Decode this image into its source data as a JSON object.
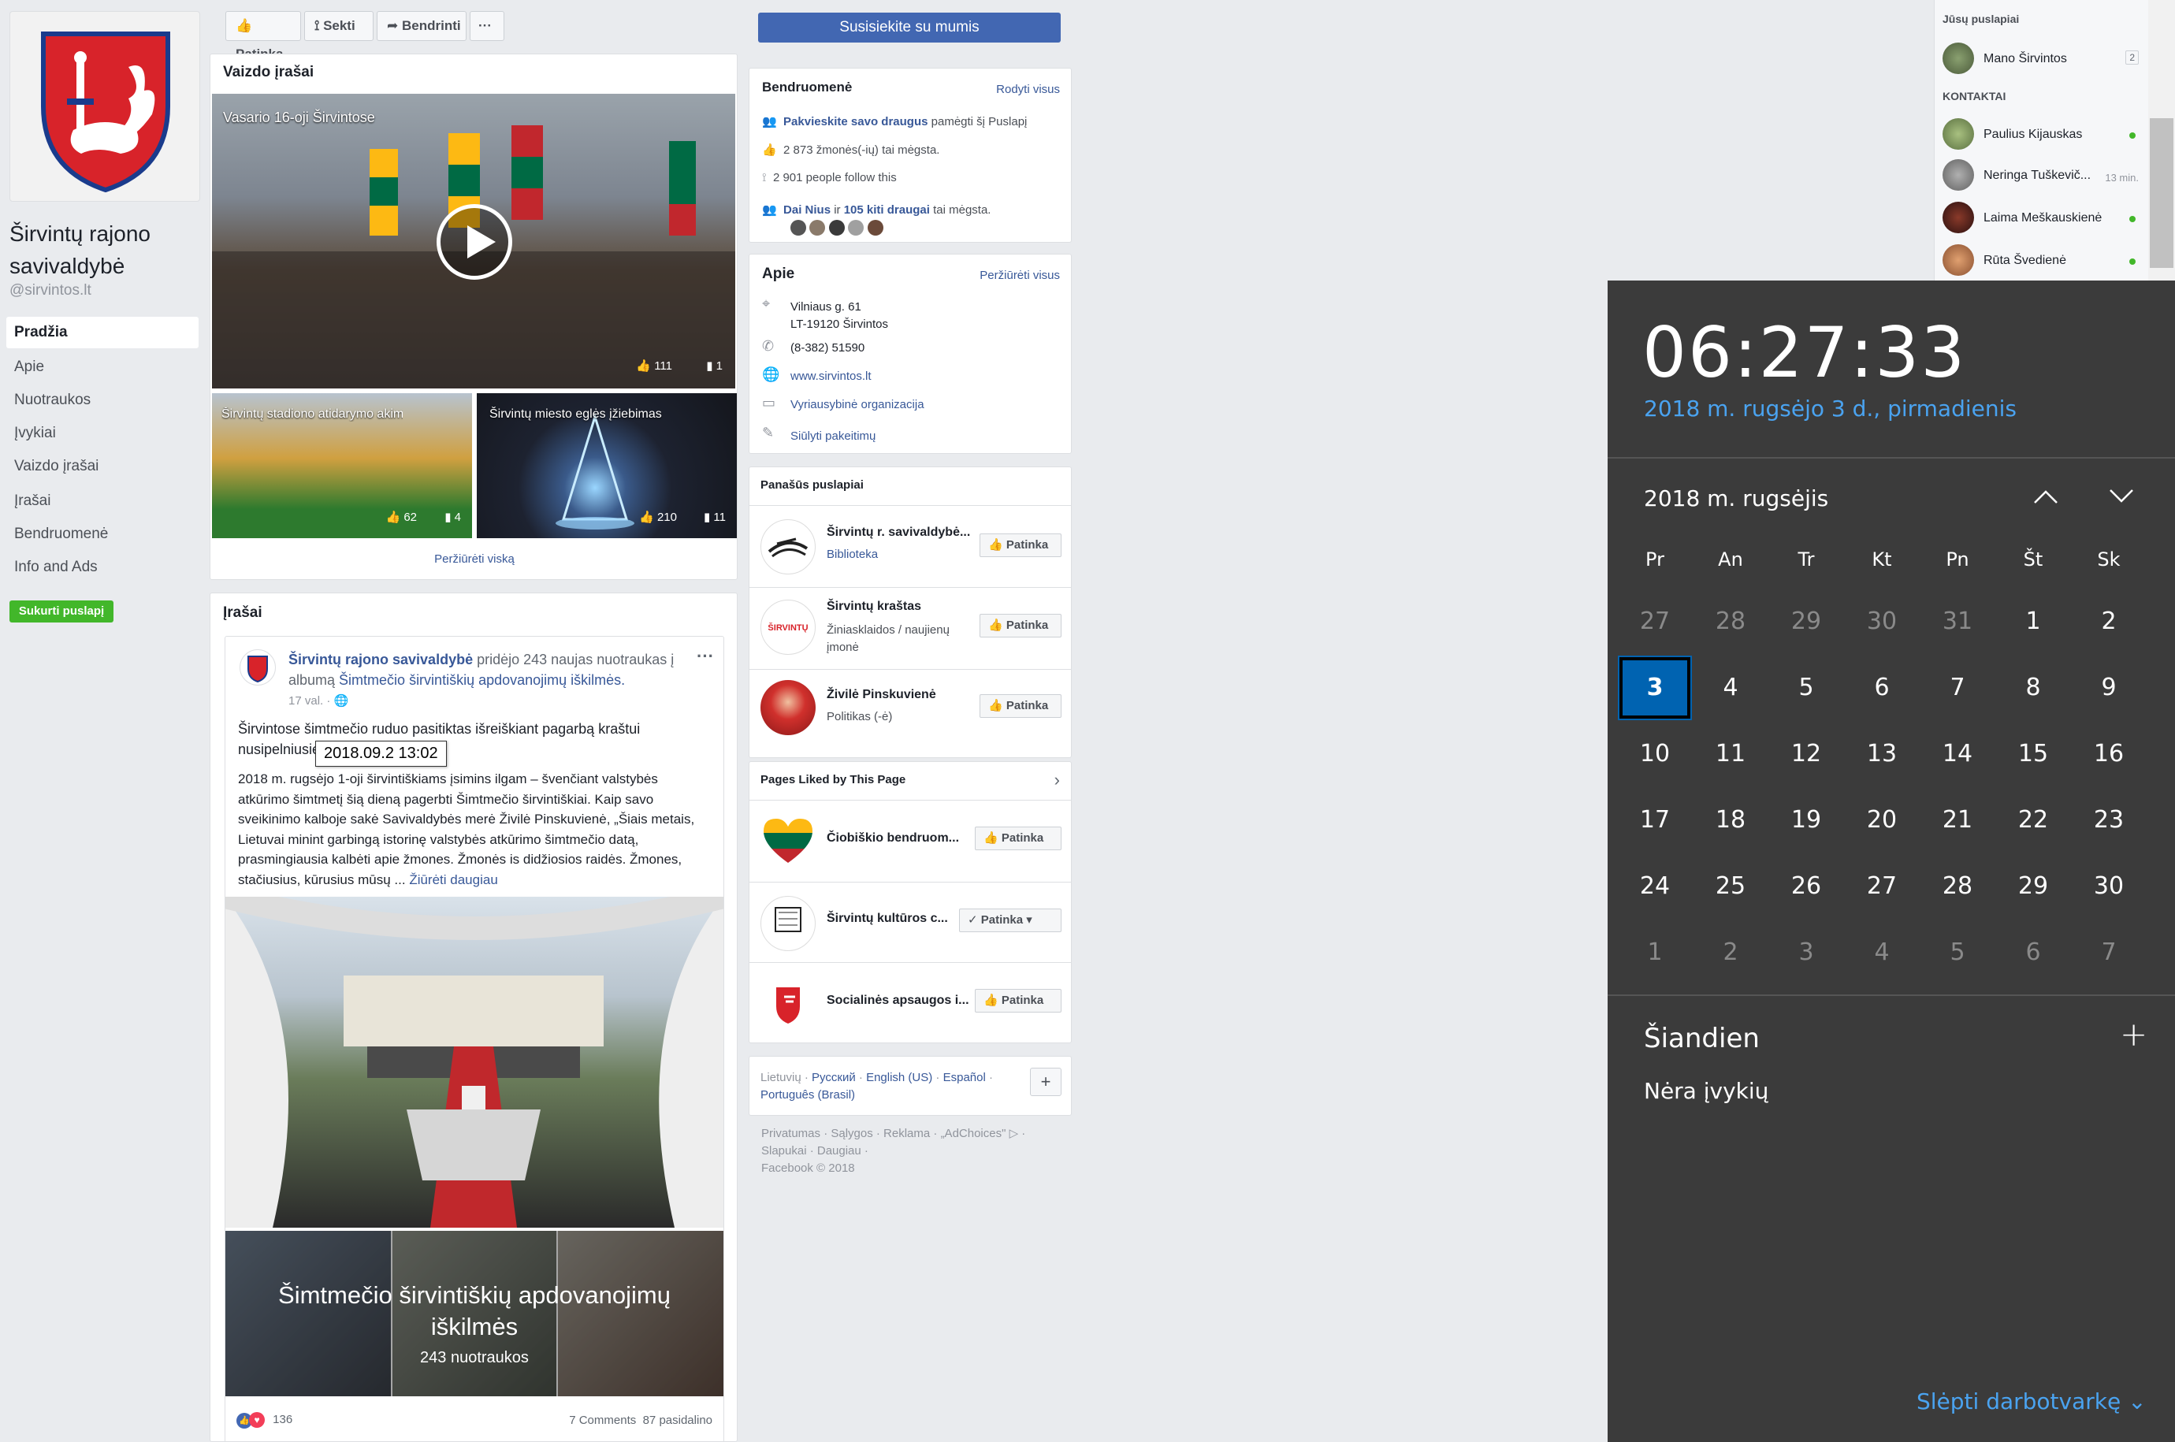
{
  "page": {
    "name": "Širvintų rajono savivaldybė",
    "handle": "@sirvintos.lt",
    "nav": [
      "Pradžia",
      "Apie",
      "Nuotraukos",
      "Įvykiai",
      "Vaizdo įrašai",
      "Įrašai",
      "Bendruomenė",
      "Info and Ads"
    ],
    "create_page": "Sukurti puslapį"
  },
  "topbar": {
    "like": "Patinka",
    "follow": "Sekti",
    "share": "Bendrinti",
    "more": "···",
    "contact": "Susisiekite su mumis"
  },
  "videos": {
    "heading": "Vaizdo įrašai",
    "main": {
      "title": "Vasario 16-oji Širvintose",
      "likes": "111",
      "comments": "1"
    },
    "v2": {
      "title": "Širvintų stadiono atidarymo akimirkos",
      "likes": "62",
      "comments": "4"
    },
    "v3": {
      "title": "Širvintų miesto eglės įžiebimas",
      "likes": "210",
      "comments": "11"
    },
    "see_all": "Peržiūrėti viską"
  },
  "posts": {
    "heading": "Įrašai",
    "author": "Širvintų rajono savivaldybė",
    "action_1": " pridėjo 243 naujas nuotraukas į albumą ",
    "album": "Šimtmečio širvintiškių apdovanojimų iškilmės.",
    "time": "17 val. · ",
    "tooltip": "2018.09.2 13:02",
    "para1a": "Širvintose šimtmečio ruduo pasitiktas išreiškiant pagarbą kraštui",
    "para1b": "nusipelniusiems.",
    "para2": "2018 m. rugsėjo 1-oji širvintiškiams įsimins ilgam – švenčiant valstybės atkūrimo šimtmetį šią dieną pagerbti Šimtmečio širvintiškiai. Kaip savo sveikinimo kalboje sakė Savivaldybės merė Živilė Pinskuvienė, „Šiais metais, Lietuvai minint garbingą istorinę valstybės atkūrimo šimtmečio datą, prasmingiausia kalbėti apie žmones. Žmonės is didžiosios raidės. Žmones, stačiusius, kūrusius mūsų ...",
    "see_more": "Žiūrėti daugiau",
    "album_title": "Šimtmečio širvintiškių apdovanojimų iškilmės",
    "album_count": "243 nuotraukos",
    "reactions": "136",
    "comments": "7 Comments",
    "shares": "87 pasidalino"
  },
  "community": {
    "heading": "Bendruomenė",
    "see_all": "Rodyti visus",
    "invite_link": "Pakvieskite savo draugus",
    "invite_rest": " pamėgti šį Puslapį",
    "likes": "2 873 žmonės(-ių) tai mėgsta.",
    "follows": "2 901 people follow this",
    "friends_a": "Dai Nius",
    "friends_mid": " ir ",
    "friends_b": "105 kiti draugai",
    "friends_rest": " tai mėgsta."
  },
  "about": {
    "heading": "Apie",
    "see_all": "Peržiūrėti visus",
    "address1": "Vilniaus g. 61",
    "address2": "LT-19120 Širvintos",
    "phone": "(8-382) 51590",
    "website": "www.sirvintos.lt",
    "category": "Vyriausybinė organizacija",
    "suggest": "Siūlyti pakeitimų"
  },
  "similar": {
    "heading": "Panašūs puslapiai",
    "items": [
      {
        "name": "Širvintų r. savivaldybė...",
        "sub": "Biblioteka",
        "btn": "Patinka"
      },
      {
        "name": "Širvintų kraštas",
        "sub": "Žiniasklaidos / naujienų įmonė",
        "btn": "Patinka"
      },
      {
        "name": "Živilė Pinskuvienė",
        "sub": "Politikas (-ė)",
        "btn": "Patinka"
      }
    ]
  },
  "liked": {
    "heading": "Pages Liked by This Page",
    "items": [
      {
        "name": "Čiobiškio bendruom...",
        "btn": "Patinka"
      },
      {
        "name": "Širvintų kultūros c...",
        "btn": "Patinka"
      },
      {
        "name": "Socialinės apsaugos i...",
        "btn": "Patinka"
      }
    ]
  },
  "languages": {
    "current": "Lietuvių",
    "sep": " · ",
    "l1": "Русский",
    "l2": "English (US)",
    "l3": "Español",
    "l4": "Português (Brasil)",
    "add": "+"
  },
  "footer": {
    "line1": "Privatumas · Sąlygos · Reklama · „AdChoices\" ▷ ·",
    "line2": "Slapukai · Daugiau ·",
    "line3": "Facebook © 2018"
  },
  "chat": {
    "your_pages": "Jūsų puslapiai",
    "my_page": "Mano Širvintos",
    "my_page_badge": "2",
    "contacts": "KONTAKTAI",
    "people": [
      {
        "name": "Paulius Kijauskas",
        "status": ""
      },
      {
        "name": "Neringa Tuškevič...",
        "status": "13 min."
      },
      {
        "name": "Laima Meškauskienė",
        "status": ""
      },
      {
        "name": "Rūta Švedienė",
        "status": ""
      }
    ]
  },
  "calendar": {
    "time": "06:27:33",
    "date": "2018 m. rugsėjo 3 d., pirmadienis",
    "month": "2018 m. rugsėjis",
    "weekdays": [
      "Pr",
      "An",
      "Tr",
      "Kt",
      "Pn",
      "Št",
      "Sk"
    ],
    "weeks": [
      [
        "27",
        "28",
        "29",
        "30",
        "31",
        "1",
        "2"
      ],
      [
        "3",
        "4",
        "5",
        "6",
        "7",
        "8",
        "9"
      ],
      [
        "10",
        "11",
        "12",
        "13",
        "14",
        "15",
        "16"
      ],
      [
        "17",
        "18",
        "19",
        "20",
        "21",
        "22",
        "23"
      ],
      [
        "24",
        "25",
        "26",
        "27",
        "28",
        "29",
        "30"
      ],
      [
        "1",
        "2",
        "3",
        "4",
        "5",
        "6",
        "7"
      ]
    ],
    "today_heading": "Šiandien",
    "no_events": "Nėra įvykių",
    "hide_agenda": "Slėpti darbotvarkę",
    "accent": "#4aa3f0",
    "selected": "#0063b1"
  }
}
